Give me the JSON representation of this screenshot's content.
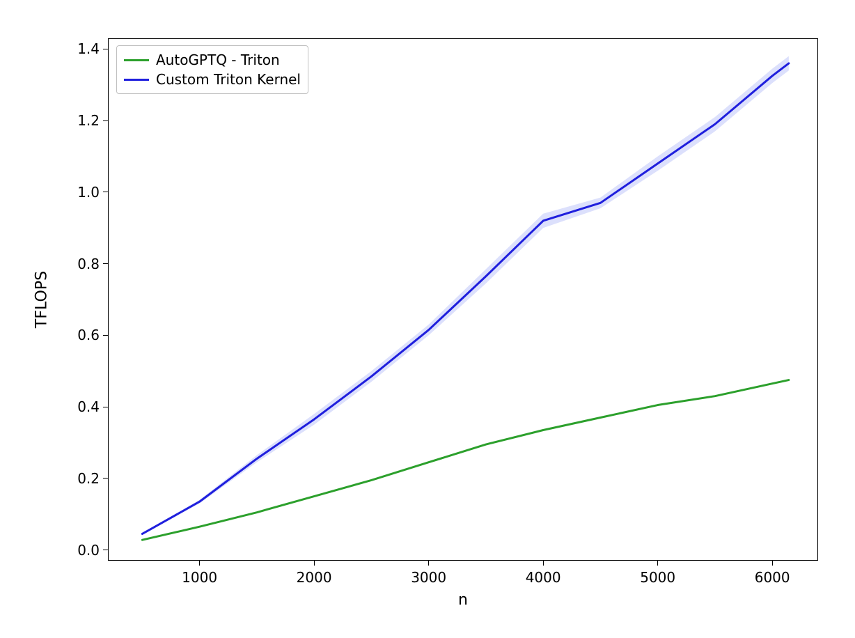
{
  "chart_data": {
    "type": "line",
    "title": "",
    "xlabel": "n",
    "ylabel": "TFLOPS",
    "xlim": [
      200,
      6400
    ],
    "ylim": [
      -0.03,
      1.43
    ],
    "x_ticks": [
      1000,
      2000,
      3000,
      4000,
      5000,
      6000
    ],
    "y_ticks": [
      0.0,
      0.2,
      0.4,
      0.6,
      0.8,
      1.0,
      1.2,
      1.4
    ],
    "x_tick_labels": [
      "1000",
      "2000",
      "3000",
      "4000",
      "5000",
      "6000"
    ],
    "y_tick_labels": [
      "0.0",
      "0.2",
      "0.4",
      "0.6",
      "0.8",
      "1.0",
      "1.2",
      "1.4"
    ],
    "x": [
      500,
      1000,
      1500,
      2000,
      2500,
      3000,
      3500,
      4000,
      4500,
      5000,
      5500,
      6000,
      6144
    ],
    "series": [
      {
        "name": "AutoGPTQ - Triton",
        "color": "#2ca02c",
        "values": [
          0.028,
          0.065,
          0.105,
          0.15,
          0.195,
          0.245,
          0.295,
          0.335,
          0.37,
          0.405,
          0.43,
          0.465,
          0.475
        ]
      },
      {
        "name": "Custom Triton Kernel",
        "color": "#1f1fdd",
        "values": [
          0.045,
          0.135,
          0.255,
          0.365,
          0.485,
          0.615,
          0.765,
          0.92,
          0.97,
          1.08,
          1.19,
          1.325,
          1.36
        ]
      }
    ],
    "band": {
      "series": "Custom Triton Kernel",
      "lo": [
        0.043,
        0.13,
        0.245,
        0.35,
        0.47,
        0.6,
        0.745,
        0.9,
        0.955,
        1.06,
        1.17,
        1.305,
        1.34
      ],
      "hi": [
        0.047,
        0.14,
        0.265,
        0.38,
        0.5,
        0.63,
        0.785,
        0.94,
        0.985,
        1.1,
        1.21,
        1.345,
        1.38
      ]
    },
    "legend_position": "upper-left"
  }
}
